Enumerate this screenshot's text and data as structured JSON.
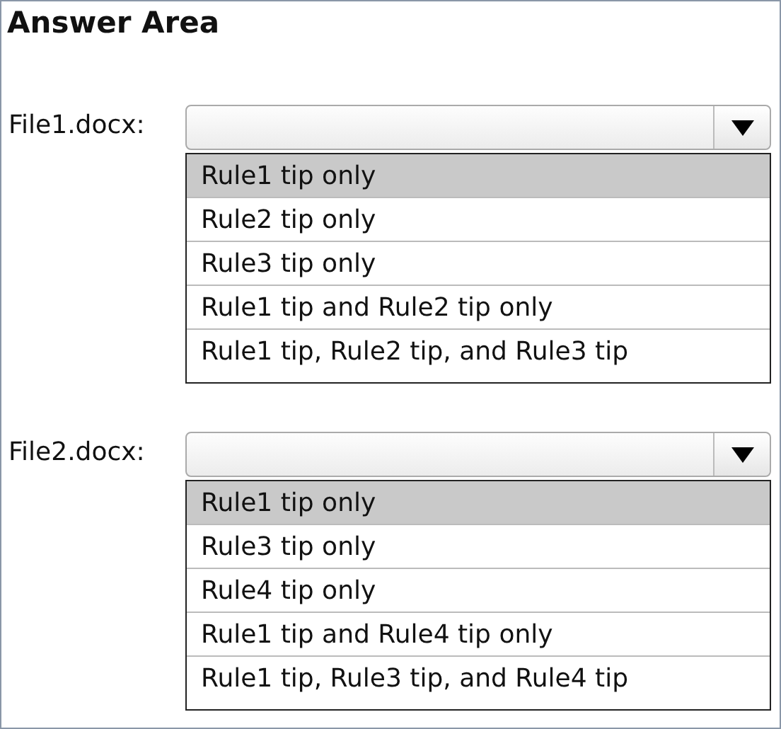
{
  "title": "Answer Area",
  "questions": [
    {
      "label": "File1.docx:",
      "options": [
        {
          "text": "Rule1 tip only",
          "selected": true
        },
        {
          "text": "Rule2 tip only",
          "selected": false
        },
        {
          "text": "Rule3 tip only",
          "selected": false
        },
        {
          "text": "Rule1 tip and Rule2 tip only",
          "selected": false
        },
        {
          "text": "Rule1 tip, Rule2 tip, and Rule3 tip",
          "selected": false
        }
      ]
    },
    {
      "label": "File2.docx:",
      "options": [
        {
          "text": "Rule1 tip only",
          "selected": true
        },
        {
          "text": "Rule3 tip only",
          "selected": false
        },
        {
          "text": "Rule4 tip only",
          "selected": false
        },
        {
          "text": "Rule1 tip and Rule4 tip only",
          "selected": false
        },
        {
          "text": "Rule1 tip, Rule3 tip, and Rule4 tip",
          "selected": false
        }
      ]
    }
  ]
}
